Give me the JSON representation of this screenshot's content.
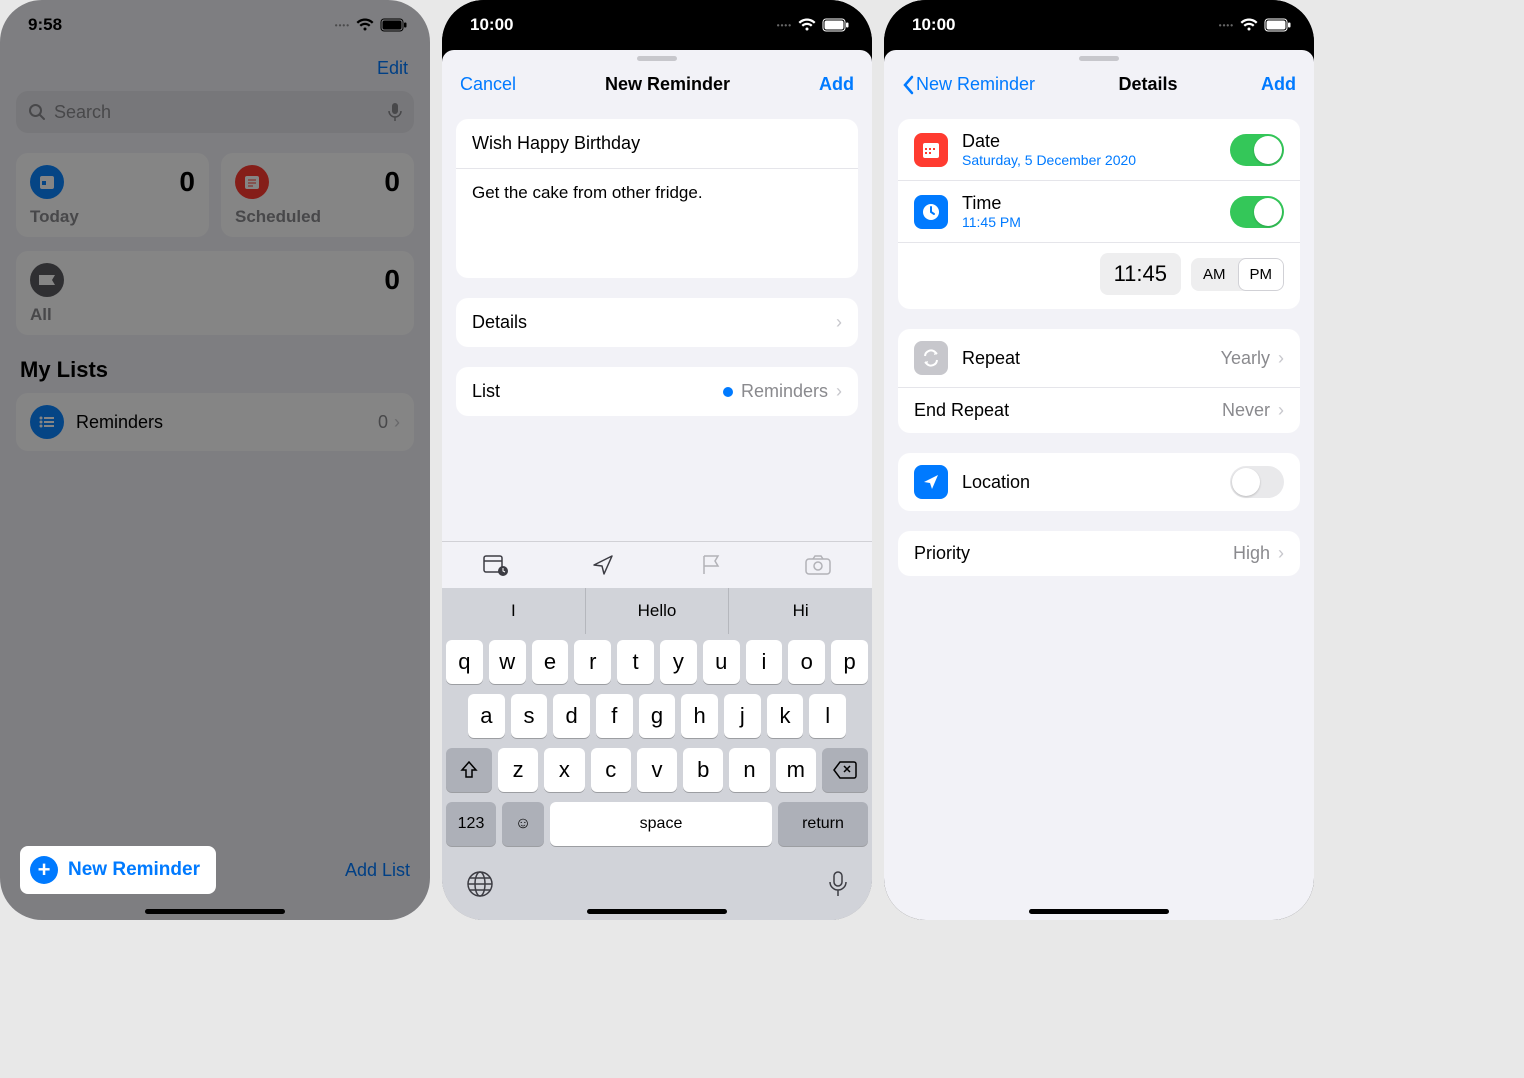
{
  "phone1": {
    "time": "9:58",
    "edit": "Edit",
    "search_placeholder": "Search",
    "cards": {
      "today": {
        "label": "Today",
        "count": "0"
      },
      "scheduled": {
        "label": "Scheduled",
        "count": "0"
      },
      "all": {
        "label": "All",
        "count": "0"
      }
    },
    "my_lists_header": "My Lists",
    "list": {
      "name": "Reminders",
      "count": "0"
    },
    "new_reminder": "New Reminder",
    "add_list": "Add List"
  },
  "phone2": {
    "time": "10:00",
    "nav": {
      "cancel": "Cancel",
      "title": "New Reminder",
      "add": "Add"
    },
    "reminder_title": "Wish Happy Birthday",
    "reminder_notes": "Get the cake from other fridge.",
    "details_label": "Details",
    "list_label": "List",
    "list_value": "Reminders",
    "suggestions": [
      "I",
      "Hello",
      "Hi"
    ],
    "keys_r1": [
      "q",
      "w",
      "e",
      "r",
      "t",
      "y",
      "u",
      "i",
      "o",
      "p"
    ],
    "keys_r2": [
      "a",
      "s",
      "d",
      "f",
      "g",
      "h",
      "j",
      "k",
      "l"
    ],
    "keys_r3": [
      "z",
      "x",
      "c",
      "v",
      "b",
      "n",
      "m"
    ],
    "key_123": "123",
    "key_space": "space",
    "key_return": "return"
  },
  "phone3": {
    "time": "10:00",
    "nav": {
      "back": "New Reminder",
      "title": "Details",
      "add": "Add"
    },
    "date": {
      "label": "Date",
      "value": "Saturday, 5 December 2020",
      "on": true
    },
    "time_row": {
      "label": "Time",
      "value": "11:45 PM",
      "on": true
    },
    "time_picker": {
      "time": "11:45",
      "am": "AM",
      "pm": "PM",
      "selected": "PM"
    },
    "repeat": {
      "label": "Repeat",
      "value": "Yearly"
    },
    "end_repeat": {
      "label": "End Repeat",
      "value": "Never"
    },
    "location": {
      "label": "Location",
      "on": false
    },
    "priority": {
      "label": "Priority",
      "value": "High"
    }
  }
}
